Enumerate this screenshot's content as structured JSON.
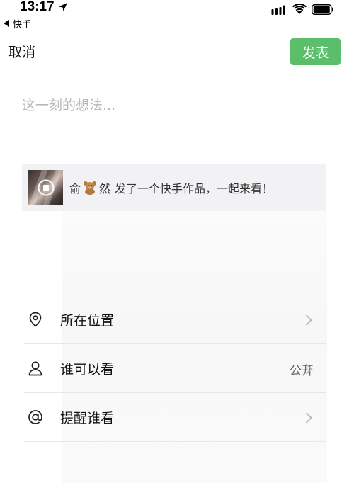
{
  "status_bar": {
    "time": "13:17",
    "back_app_label": "快手"
  },
  "header": {
    "cancel_label": "取消",
    "publish_label": "发表"
  },
  "composer": {
    "placeholder": "这一刻的想法..."
  },
  "share_card": {
    "name_first": "俞",
    "name_second": "然",
    "message": "发了一个快手作品，一起来看！"
  },
  "options": {
    "location": {
      "label": "所在位置",
      "icon": "location-pin-icon"
    },
    "visibility": {
      "label": "谁可以看",
      "value": "公开",
      "icon": "person-icon"
    },
    "remind": {
      "label": "提醒谁看",
      "icon": "at-sign-icon"
    }
  },
  "colors": {
    "accent": "#5bbe6a",
    "card_bg": "#f2f2f4",
    "placeholder": "#b9b9b9",
    "divider": "#e7e7e7"
  }
}
